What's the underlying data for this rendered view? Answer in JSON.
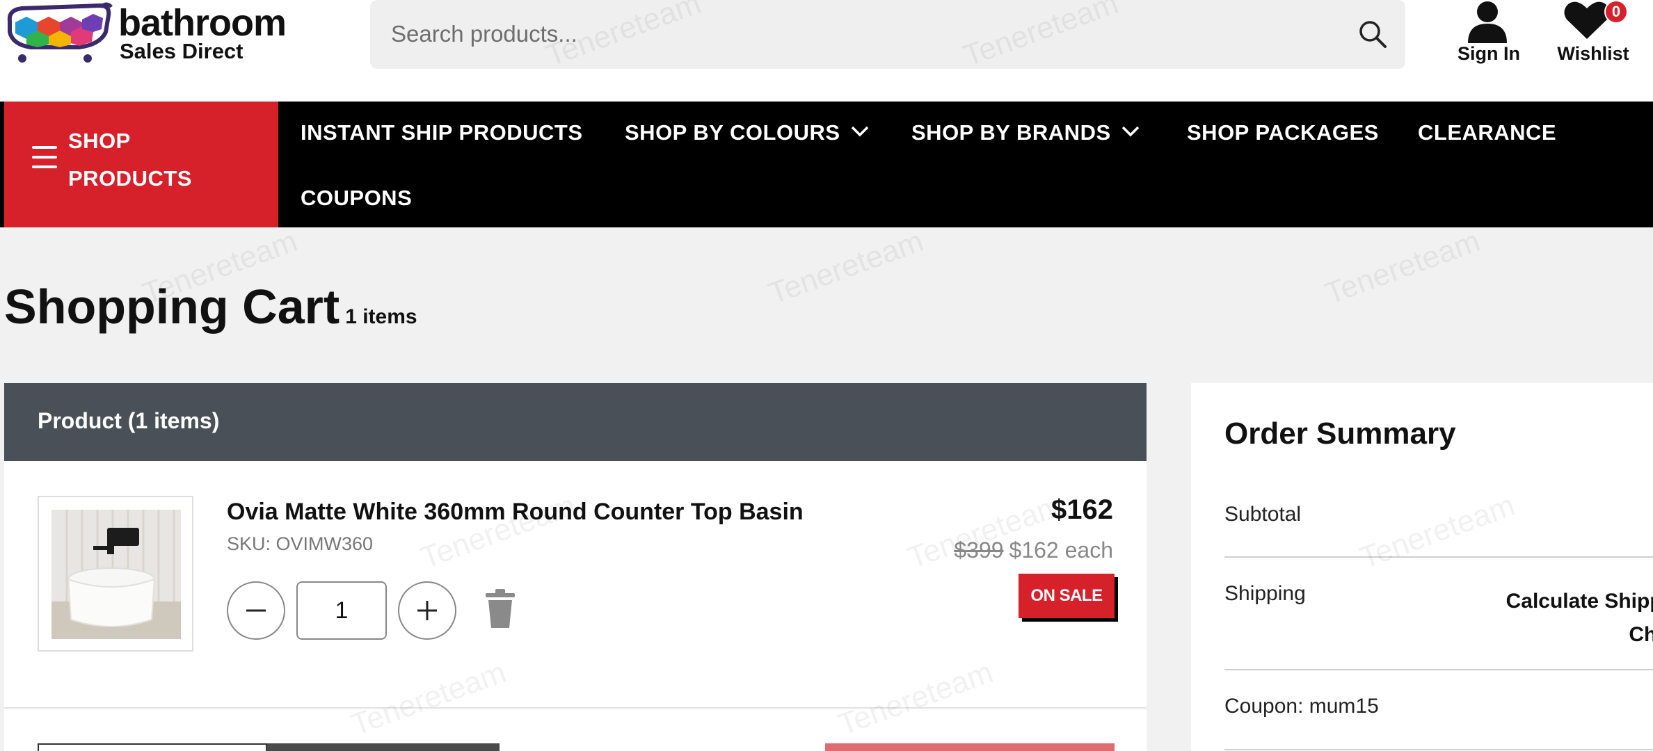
{
  "header": {
    "logo_word": "bathroom",
    "logo_sub": "Sales Direct",
    "search_placeholder": "Search products...",
    "sign_in_label": "Sign In",
    "wishlist_label": "Wishlist",
    "wishlist_count": "0"
  },
  "nav": {
    "shop_products_label": "SHOP PRODUCTS",
    "items": [
      {
        "label": "INSTANT SHIP PRODUCTS"
      },
      {
        "label": "SHOP BY COLOURS"
      },
      {
        "label": "SHOP BY BRANDS"
      },
      {
        "label": "SHOP PACKAGES"
      },
      {
        "label": "CLEARANCE"
      },
      {
        "label": "COUPONS"
      }
    ]
  },
  "page": {
    "title": "Shopping Cart",
    "item_count": "1 items"
  },
  "cart": {
    "header": "Product (1 items)",
    "item": {
      "name": "Ovia Matte White 360mm Round Counter Top Basin",
      "sku": "SKU: OVIMW360",
      "quantity": "1",
      "price": "$162",
      "was_price": "$399",
      "each_price": "$162 each",
      "sale_badge": "ON SALE"
    }
  },
  "summary": {
    "title": "Order Summary",
    "subtotal_label": "Subtotal",
    "shipping_label": "Shipping",
    "shipping_value_line1": "Calculate Shippi",
    "shipping_value_line2": "Che",
    "coupon_label": "Coupon: mum15"
  },
  "watermark": "Tenereteam",
  "colors": {
    "brand_red": "#d6212b",
    "nav_black": "#000000",
    "cart_header": "#4a5058"
  }
}
